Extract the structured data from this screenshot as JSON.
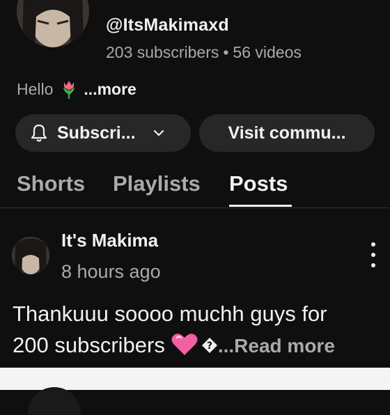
{
  "channel": {
    "handle": "@ItsMakimaxd",
    "subscribers": "203 subscribers",
    "separator": "•",
    "videos": "56 videos",
    "description": "Hello",
    "description_emoji": "tulip-emoji",
    "more_label": "...more",
    "avatar": "channel-avatar"
  },
  "actions": {
    "subscribe_label": "Subscri...",
    "subscribe_icon": "bell-icon",
    "subscribe_dropdown_icon": "chevron-down-icon",
    "visit_label": "Visit commu..."
  },
  "tabs": [
    {
      "label": "Shorts",
      "active": false
    },
    {
      "label": "Playlists",
      "active": false
    },
    {
      "label": "Posts",
      "active": true
    }
  ],
  "post": {
    "author": "It's Makima",
    "time": "8 hours ago",
    "text_line1": "Thankuuu soooo muchh guys for",
    "text_line2": "200 subscribers",
    "emoji": "pink-heart-emoji",
    "read_more": "...Read more",
    "menu_icon": "more-vert-icon"
  },
  "colors": {
    "background": "#0f0f0f",
    "text_primary": "#f1f1f1",
    "text_secondary": "#aaaaaa",
    "button_bg": "#272727"
  }
}
